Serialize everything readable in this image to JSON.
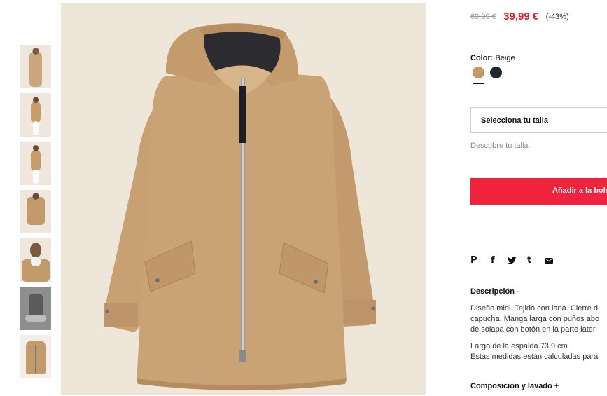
{
  "product": {
    "old_price": "69,99 €",
    "new_price": "39,99 €",
    "discount": "(-43%)",
    "color_label": "Color:",
    "color_value": "Beige",
    "colors": [
      "#c39b6a",
      "#1e2530"
    ],
    "size_select": "Selecciona tu talla",
    "size_link": "Descubre tu talla",
    "add_button": "Añadir a la bolsa",
    "accent_color": "#ef233c",
    "price_color": "#e51f2f"
  },
  "share": {
    "icons": [
      "pinterest-icon",
      "facebook-icon",
      "twitter-icon",
      "tumblr-icon",
      "email-icon"
    ],
    "p": "P",
    "f": "f",
    "t": "t"
  },
  "description": {
    "title": "Descripción -",
    "lines": [
      "Diseño midi. Tejido con lana. Cierre d",
      "capucha. Manga larga con puños abo",
      "de solapa con botón en la parte later"
    ],
    "measure_1": "Largo de la espalda 73.9 cm",
    "measure_2": "Estas medidas están calculadas para"
  },
  "composition": {
    "title": "Composición y lavado +"
  }
}
